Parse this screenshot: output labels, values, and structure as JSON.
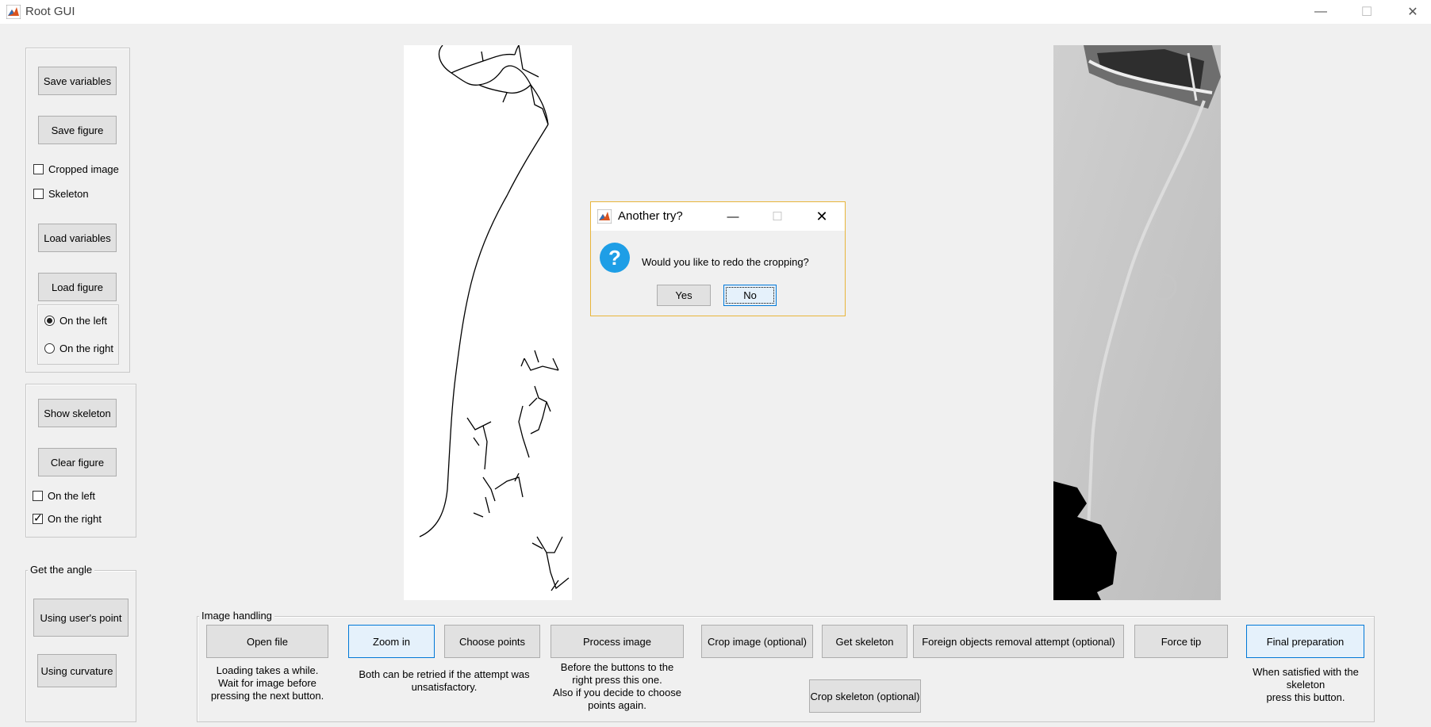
{
  "window": {
    "title": "Root GUI"
  },
  "left_panel": {
    "save_variables": "Save variables",
    "save_figure": "Save figure",
    "cropped_image": "Cropped image",
    "skeleton": "Skeleton",
    "load_variables": "Load variables",
    "load_figure": "Load figure",
    "on_the_left": "On the left",
    "on_the_right": "On the right",
    "load_selected": "On the left"
  },
  "show_panel": {
    "show_skeleton": "Show skeleton",
    "clear_figure": "Clear figure",
    "on_the_left": "On the left",
    "on_the_right": "On the right",
    "left_checked": false,
    "right_checked": true
  },
  "angle_panel": {
    "title": "Get the angle",
    "using_users_point": "Using user's point",
    "using_curvature": "Using curvature"
  },
  "image_handling": {
    "title": "Image handling",
    "open_file": "Open file",
    "zoom_in": "Zoom in",
    "choose_points": "Choose points",
    "process_image": "Process image",
    "crop_image": "Crop image (optional)",
    "get_skeleton": "Get skeleton",
    "foreign_objects": "Foreign objects removal attempt (optional)",
    "force_tip": "Force tip",
    "final_preparation": "Final preparation",
    "crop_skeleton": "Crop skeleton (optional)",
    "help_open": [
      "Loading takes a while.",
      "Wait for  image before",
      "pressing the next button."
    ],
    "help_zoom": [
      "Both can be retried if the attempt was",
      "unsatisfactory."
    ],
    "help_process": [
      "Before the buttons to the",
      "right press this one.",
      "Also if you decide to choose",
      "points again."
    ],
    "help_final": [
      "When satisfied with the",
      "skeleton",
      "press this button."
    ]
  },
  "dialog": {
    "title": "Another try?",
    "message": "Would you like to redo the cropping?",
    "yes": "Yes",
    "no": "No"
  },
  "colors": {
    "accent": "#0078d7",
    "question_icon": "#1e9ee6",
    "dialog_border": "#e8b53a"
  }
}
